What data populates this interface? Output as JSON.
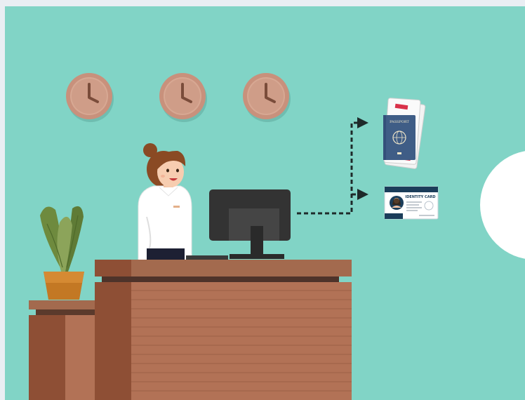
{
  "passport": {
    "label": "PASSPORT"
  },
  "id_card": {
    "label": "IDENTITY CARD"
  },
  "colors": {
    "background": "#81d4c6",
    "outer_frame": "#e9eef3",
    "desk_top": "#a36a4e",
    "desk_front": "#b27256",
    "passport_cover": "#3f5d86",
    "id_header": "#1b3d5a",
    "monitor": "#333333"
  },
  "icons": {
    "clocks": [
      "clock-icon",
      "clock-icon",
      "clock-icon"
    ],
    "flow": [
      "arrow-right-icon",
      "arrow-right-icon"
    ],
    "documents": [
      "passport-icon",
      "id-card-icon"
    ]
  }
}
